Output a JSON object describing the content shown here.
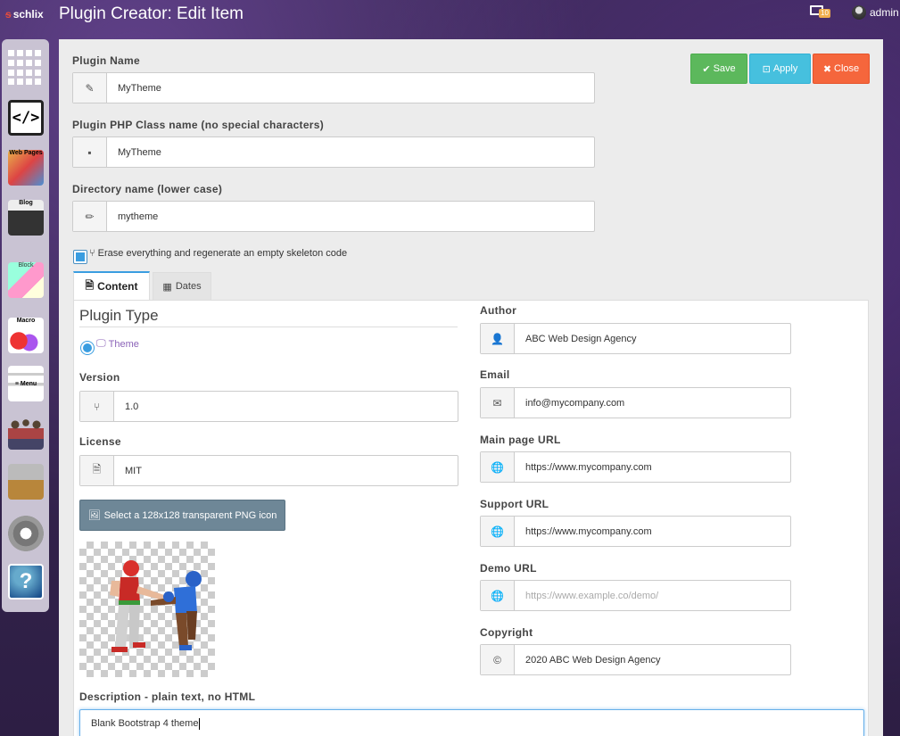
{
  "topbar": {
    "brand": "schlix",
    "title": "Plugin Creator: Edit Item",
    "notification_count": "10",
    "user_name": "admin"
  },
  "sidebar": {
    "items": [
      {
        "name": "apps-grid",
        "label": ""
      },
      {
        "name": "plugin-creator",
        "label": ""
      },
      {
        "name": "web-pages",
        "label": "Web Pages"
      },
      {
        "name": "blog",
        "label": "Blog"
      },
      {
        "name": "blocks",
        "label": "Block"
      },
      {
        "name": "macro",
        "label": "Macro"
      },
      {
        "name": "menu",
        "label": "≡ Menu"
      },
      {
        "name": "users",
        "label": ""
      },
      {
        "name": "tools",
        "label": ""
      },
      {
        "name": "settings",
        "label": ""
      },
      {
        "name": "help",
        "label": "?"
      }
    ]
  },
  "toolbar": {
    "save_label": "Save",
    "apply_label": "Apply",
    "close_label": "Close"
  },
  "form": {
    "plugin_name_label": "Plugin Name",
    "plugin_name_value": "MyTheme",
    "class_name_label": "Plugin PHP Class name (no special characters)",
    "class_name_value": "MyTheme",
    "dir_name_label": "Directory name (lower case)",
    "dir_name_value": "mytheme",
    "regenerate_label": "Erase everything and regenerate an empty skeleton code",
    "regenerate_checked": true
  },
  "tabs": [
    {
      "label": "Content",
      "active": true
    },
    {
      "label": "Dates",
      "active": false
    }
  ],
  "content": {
    "plugin_type_heading": "Plugin Type",
    "plugin_type_option": "Theme",
    "version_label": "Version",
    "version_value": "1.0",
    "license_label": "License",
    "license_value": "MIT",
    "icon_button_label": "Select a 128x128 transparent PNG icon",
    "author_label": "Author",
    "author_value": "ABC Web Design Agency",
    "email_label": "Email",
    "email_value": "info@mycompany.com",
    "main_url_label": "Main page URL",
    "main_url_value": "https://www.mycompany.com",
    "support_url_label": "Support URL",
    "support_url_value": "https://www.mycompany.com",
    "demo_url_label": "Demo URL",
    "demo_url_placeholder": "https://www.example.co/demo/",
    "copyright_label": "Copyright",
    "copyright_value": "2020 ABC Web Design Agency",
    "description_label": "Description - plain text, no HTML",
    "description_value": "Blank Bootstrap 4 theme"
  },
  "colors": {
    "save": "#5cb85c",
    "apply": "#46c0de",
    "close": "#f5663c",
    "accent": "#3a9de0",
    "icon_button": "#6e8797"
  }
}
